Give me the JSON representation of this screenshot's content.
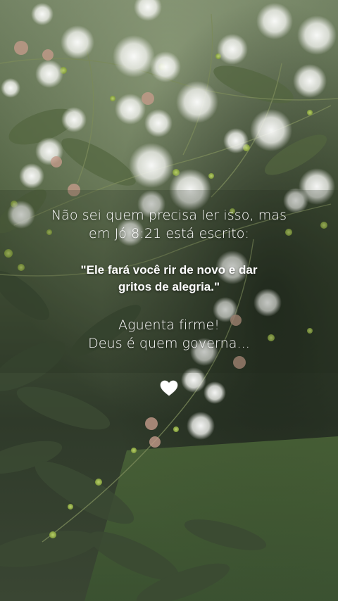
{
  "message": {
    "intro_line_1": "Não sei quem precisa ler isso, mas",
    "intro_line_2": "em Jó 8:21 está escrito:",
    "quote_line_1": "\"Ele fará você rir de novo e dar",
    "quote_line_2": "gritos de alegria.\"",
    "closing_line_1": "Aguenta firme!",
    "closing_line_2": "Deus é quem governa..."
  },
  "decorations": {
    "heart_icon": "white-heart",
    "text_color": "#ffffff"
  },
  "background": {
    "subject": "white puffball flowers on green foliage",
    "palette": [
      "#2f3d2a",
      "#4d5f3e",
      "#7f9165",
      "#e9eae6"
    ]
  }
}
